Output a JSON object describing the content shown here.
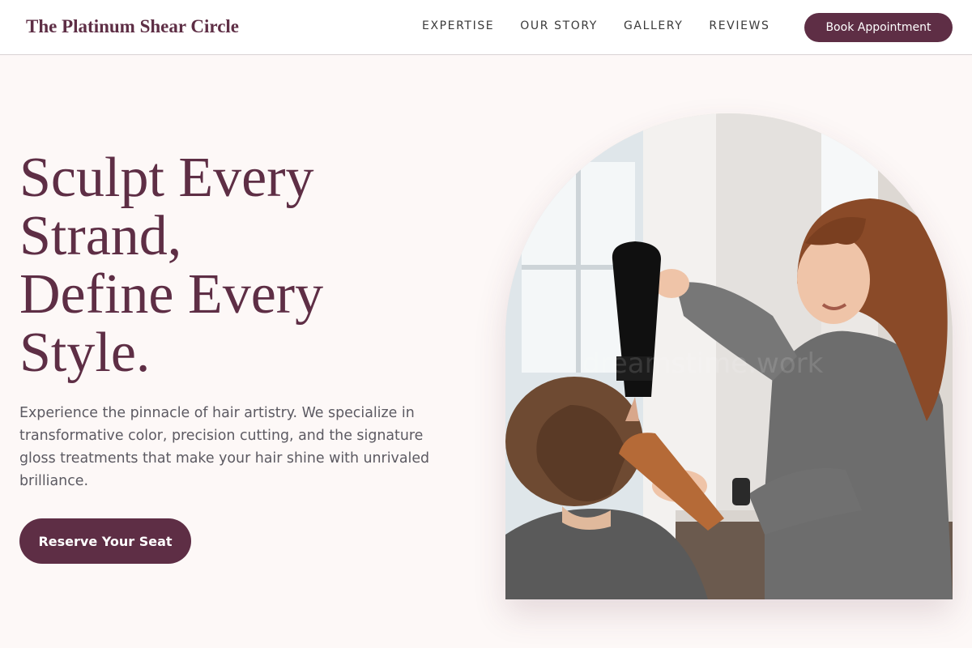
{
  "header": {
    "brand": "The Platinum Shear Circle",
    "nav": [
      "EXPERTISE",
      "OUR STORY",
      "GALLERY",
      "REVIEWS"
    ],
    "book_label": "Book Appointment"
  },
  "hero": {
    "headline_lines": [
      "Sculpt Every",
      "Strand,",
      "Define Every",
      "Style."
    ],
    "lead": "Experience the pinnacle of hair artistry. We specialize in transformative color, precision cutting, and the signature gloss treatments that make your hair shine with unrivaled brilliance.",
    "cta_label": "Reserve Your Seat"
  },
  "colors": {
    "brand": "#5e2e45",
    "background": "#fdf8f7",
    "text_muted": "#5c5a62"
  }
}
